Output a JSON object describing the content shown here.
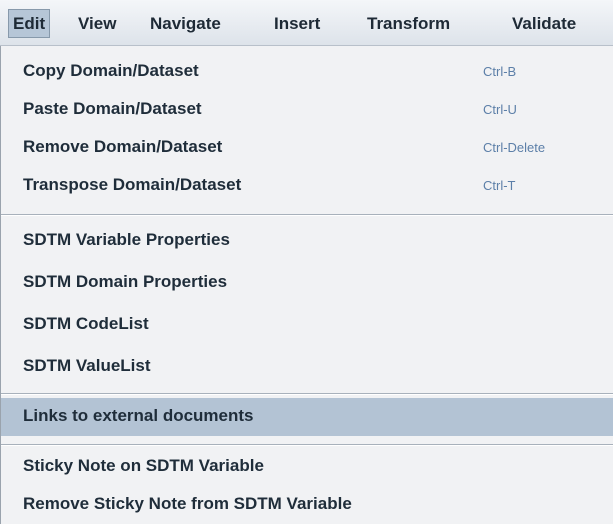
{
  "menubar": {
    "items": [
      {
        "label": "Edit"
      },
      {
        "label": "View"
      },
      {
        "label": "Navigate"
      },
      {
        "label": "Insert"
      },
      {
        "label": "Transform"
      },
      {
        "label": "Validate"
      }
    ],
    "active": "Edit"
  },
  "menu": {
    "groups": [
      [
        {
          "label": "Copy Domain/Dataset",
          "shortcut": "Ctrl-B"
        },
        {
          "label": "Paste Domain/Dataset",
          "shortcut": "Ctrl-U"
        },
        {
          "label": "Remove Domain/Dataset",
          "shortcut": "Ctrl-Delete"
        },
        {
          "label": "Transpose Domain/Dataset",
          "shortcut": "Ctrl-T"
        }
      ],
      [
        {
          "label": "SDTM Variable Properties"
        },
        {
          "label": "SDTM Domain Properties"
        },
        {
          "label": "SDTM CodeList"
        },
        {
          "label": "SDTM ValueList"
        }
      ],
      [
        {
          "label": "Links to external documents"
        }
      ],
      [
        {
          "label": "Sticky Note on SDTM Variable"
        },
        {
          "label": "Remove Sticky Note from SDTM Variable"
        }
      ]
    ],
    "highlighted": "Links to external documents"
  },
  "colors": {
    "highlight": "#b3c3d4",
    "shortcut_text": "#5c7fa8",
    "menu_background": "#f1f2f4"
  }
}
